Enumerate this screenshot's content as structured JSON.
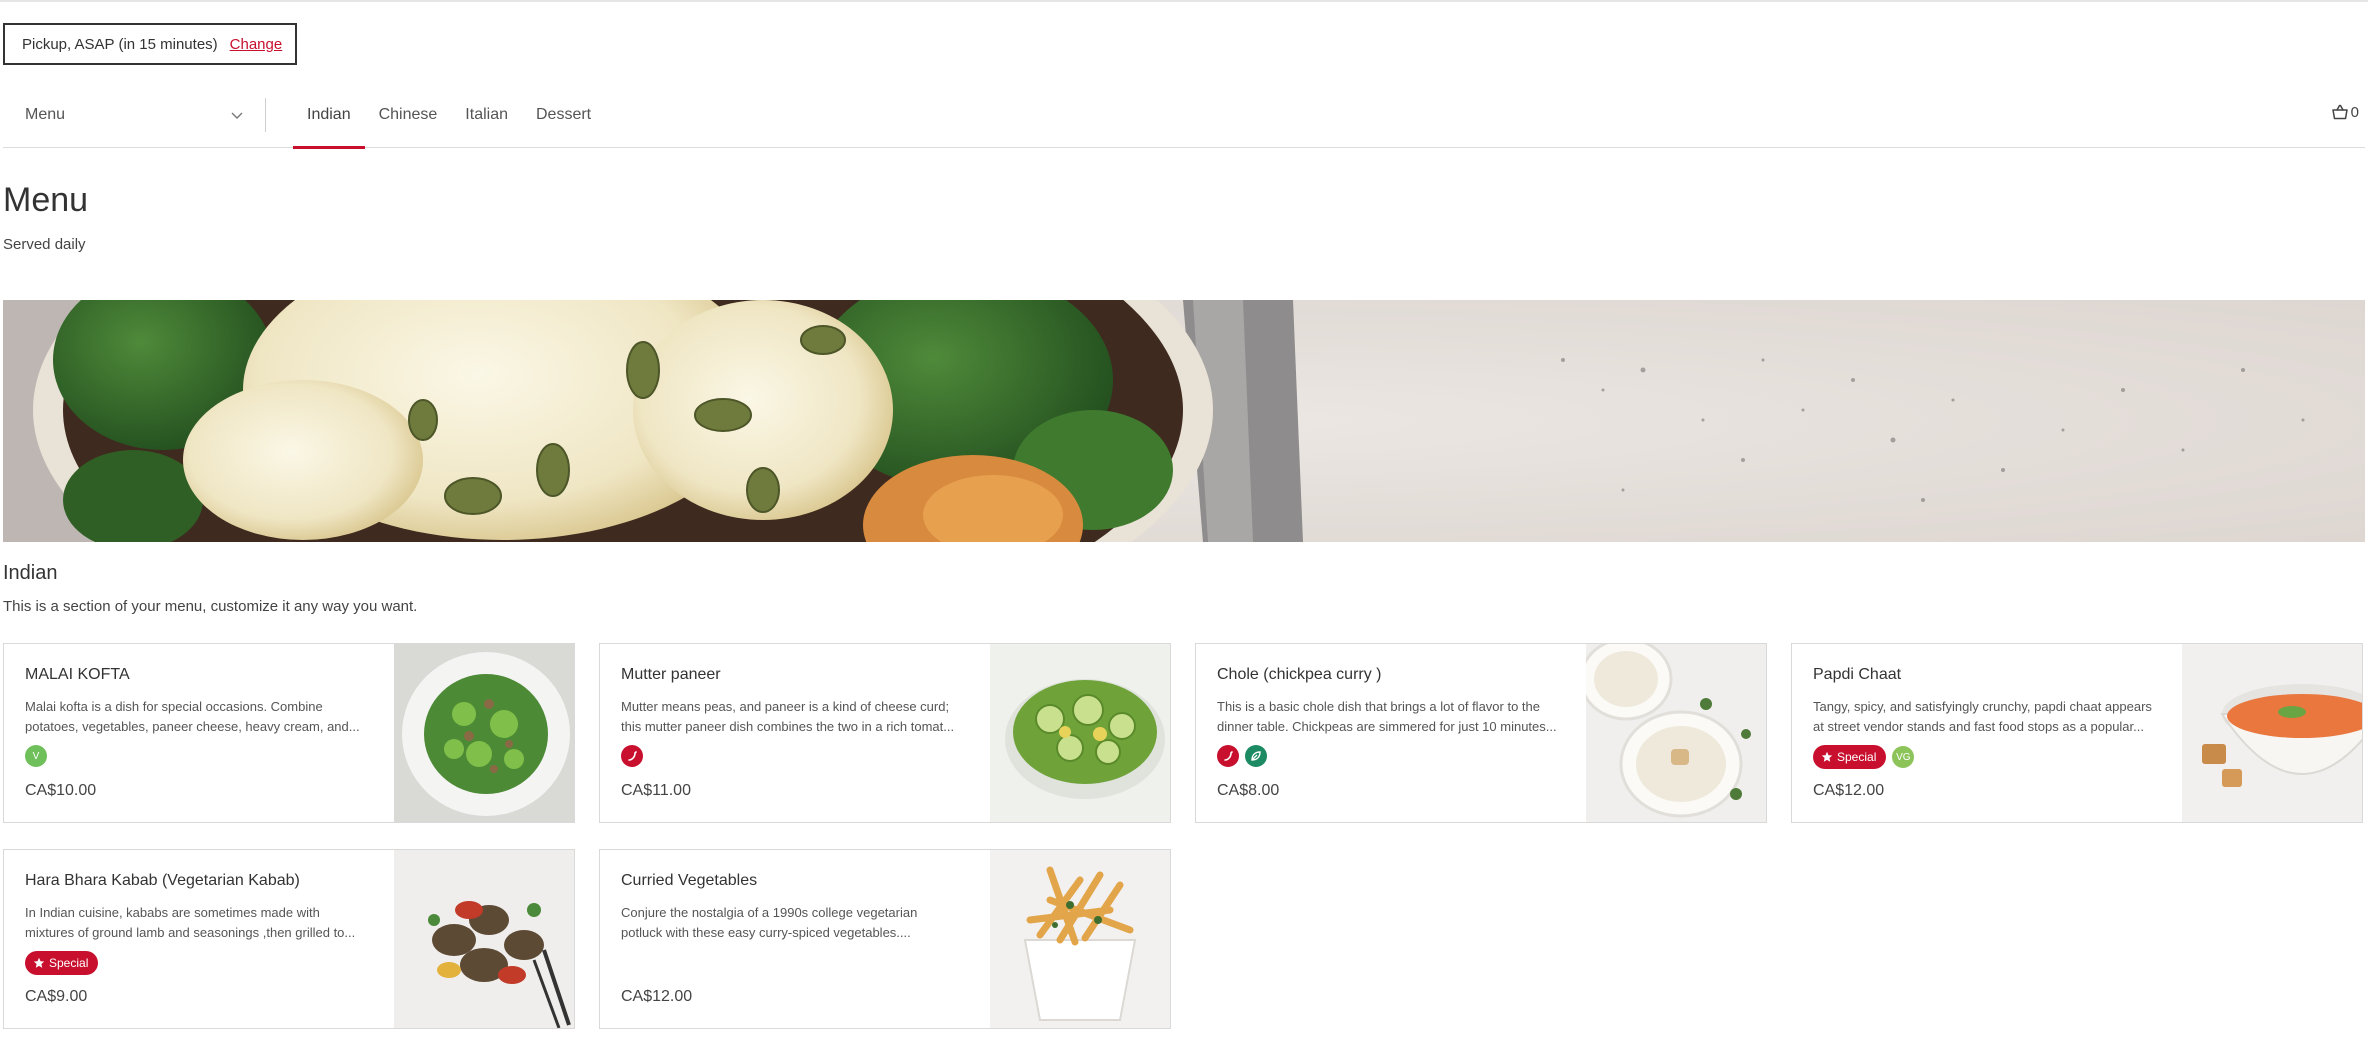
{
  "pickup": {
    "text": "Pickup, ASAP (in 15 minutes)",
    "change_label": "Change"
  },
  "nav": {
    "menu_select": "Menu",
    "tabs": [
      {
        "label": "Indian",
        "active": true
      },
      {
        "label": "Chinese",
        "active": false
      },
      {
        "label": "Italian",
        "active": false
      },
      {
        "label": "Dessert",
        "active": false
      }
    ],
    "cart_count": "0"
  },
  "page": {
    "title": "Menu",
    "subtitle": "Served daily"
  },
  "section": {
    "title": "Indian",
    "description": "This is a section of your menu, customize it any way you want."
  },
  "items": [
    {
      "name": "MALAI KOFTA",
      "description": "Malai kofta is a dish for special occasions. Combine potatoes, vegetables, paneer cheese, heavy cream, and...",
      "tags": [
        {
          "type": "vegetarian",
          "label": "V"
        }
      ],
      "price": "CA$10.00"
    },
    {
      "name": "Mutter paneer",
      "description": "Mutter means peas, and paneer is a kind of cheese curd; this mutter paneer dish combines the two in a rich tomat...",
      "tags": [
        {
          "type": "spicy",
          "label": ""
        }
      ],
      "price": "CA$11.00"
    },
    {
      "name": "Chole (chickpea curry )",
      "description": "This is a basic chole dish that brings a lot of flavor to the dinner table. Chickpeas are simmered for just 10 minutes...",
      "tags": [
        {
          "type": "spicy",
          "label": ""
        },
        {
          "type": "gluten-free",
          "label": ""
        }
      ],
      "price": "CA$8.00"
    },
    {
      "name": "Papdi Chaat",
      "description": "Tangy, spicy, and satisfyingly crunchy, papdi chaat appears at street vendor stands and fast food stops as a popular...",
      "tags": [
        {
          "type": "special",
          "label": "Special"
        },
        {
          "type": "vegan",
          "label": "VG"
        }
      ],
      "price": "CA$12.00"
    },
    {
      "name": "Hara Bhara Kabab (Vegetarian Kabab)",
      "description": "In Indian cuisine, kababs are sometimes made with mixtures of ground lamb and seasonings ,then grilled to...",
      "tags": [
        {
          "type": "special",
          "label": "Special"
        }
      ],
      "price": "CA$9.00"
    },
    {
      "name": "Curried Vegetables",
      "description": "Conjure the nostalgia of a 1990s college vegetarian potluck with these easy curry-spiced vegetables....",
      "tags": [],
      "price": "CA$12.00"
    }
  ],
  "colors": {
    "accent": "#c8102e",
    "vegetarian": "#6fbf5b",
    "vegan": "#8dc45a",
    "gluten_free": "#1c8a63"
  }
}
